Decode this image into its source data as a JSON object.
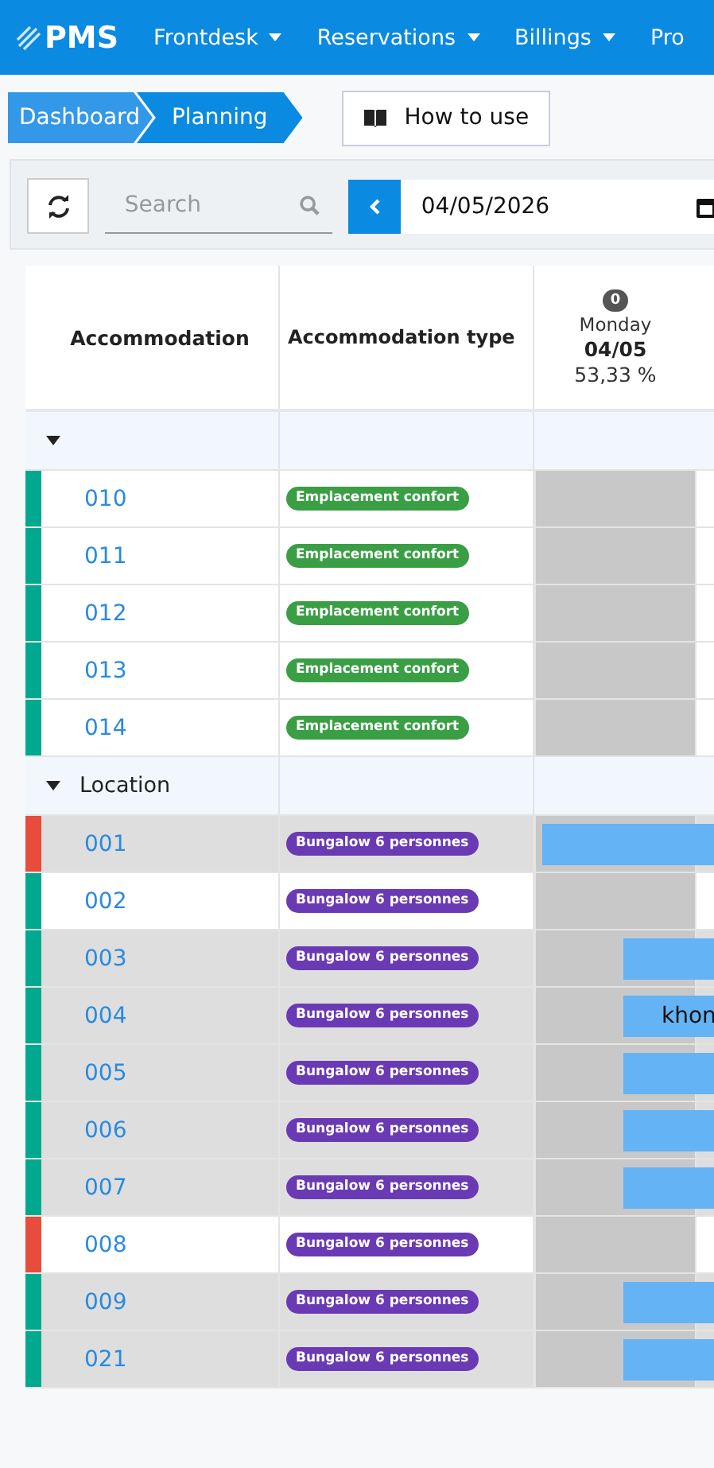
{
  "navbar": {
    "logo": "PMS",
    "items": [
      {
        "label": "Frontdesk",
        "dropdown": true
      },
      {
        "label": "Reservations",
        "dropdown": true
      },
      {
        "label": "Billings",
        "dropdown": true
      },
      {
        "label": "Pro",
        "dropdown": false
      }
    ]
  },
  "breadcrumb": [
    {
      "label": "Dashboard",
      "selected": false
    },
    {
      "label": "Planning",
      "selected": true
    }
  ],
  "help_button": {
    "label": "How to use"
  },
  "toolbar": {
    "search": {
      "placeholder": "Search"
    },
    "date": {
      "value": "04/05/2026"
    }
  },
  "table": {
    "columns": [
      {
        "label": "Accommodation"
      },
      {
        "label": "Accommodation type"
      }
    ],
    "day": {
      "count": "0",
      "weekday": "Monday",
      "date": "04/05",
      "occupancy": "53,33 %"
    },
    "groups": [
      {
        "expanded": true,
        "rows": [
          {
            "number": "010",
            "type_tag": {
              "label": "Emplacement confort",
              "color": "#3a9e45"
            },
            "color": "#00a88f"
          },
          {
            "number": "011",
            "type_tag": {
              "label": "Emplacement confort",
              "color": "#3a9e45"
            },
            "color": "#00a88f"
          },
          {
            "number": "012",
            "type_tag": {
              "label": "Emplacement confort",
              "color": "#3a9e45"
            },
            "color": "#00a88f"
          },
          {
            "number": "013",
            "type_tag": {
              "label": "Emplacement confort",
              "color": "#3a9e45"
            },
            "color": "#00a88f"
          },
          {
            "number": "014",
            "type_tag": {
              "label": "Emplacement confort",
              "color": "#3a9e45"
            },
            "color": "#00a88f"
          }
        ]
      },
      {
        "label": "Location",
        "expanded": true,
        "rows": [
          {
            "number": "001",
            "type_tag": {
              "label": "Bungalow 6 personnes",
              "color": "#6a3ab5"
            },
            "color": "#e74c3c",
            "booking": {
              "kind": "full"
            }
          },
          {
            "number": "002",
            "type_tag": {
              "label": "Bungalow 6 personnes",
              "color": "#6a3ab5"
            },
            "color": "#00a88f"
          },
          {
            "number": "003",
            "type_tag": {
              "label": "Bungalow 6 personnes",
              "color": "#6a3ab5"
            },
            "color": "#00a88f",
            "booking": {
              "kind": "partial"
            }
          },
          {
            "number": "004",
            "type_tag": {
              "label": "Bungalow 6 personnes",
              "color": "#6a3ab5"
            },
            "color": "#00a88f",
            "booking": {
              "kind": "partial",
              "label": "khon"
            }
          },
          {
            "number": "005",
            "type_tag": {
              "label": "Bungalow 6 personnes",
              "color": "#6a3ab5"
            },
            "color": "#00a88f",
            "booking": {
              "kind": "partial"
            }
          },
          {
            "number": "006",
            "type_tag": {
              "label": "Bungalow 6 personnes",
              "color": "#6a3ab5"
            },
            "color": "#00a88f",
            "booking": {
              "kind": "partial"
            }
          },
          {
            "number": "007",
            "type_tag": {
              "label": "Bungalow 6 personnes",
              "color": "#6a3ab5"
            },
            "color": "#00a88f",
            "booking": {
              "kind": "partial"
            }
          },
          {
            "number": "008",
            "type_tag": {
              "label": "Bungalow 6 personnes",
              "color": "#6a3ab5"
            },
            "color": "#e74c3c"
          },
          {
            "number": "009",
            "type_tag": {
              "label": "Bungalow 6 personnes",
              "color": "#6a3ab5"
            },
            "color": "#00a88f",
            "booking": {
              "kind": "partial"
            }
          },
          {
            "number": "021",
            "type_tag": {
              "label": "Bungalow 6 personnes",
              "color": "#6a3ab5"
            },
            "color": "#00a88f",
            "booking": {
              "kind": "partial"
            }
          }
        ]
      }
    ]
  }
}
